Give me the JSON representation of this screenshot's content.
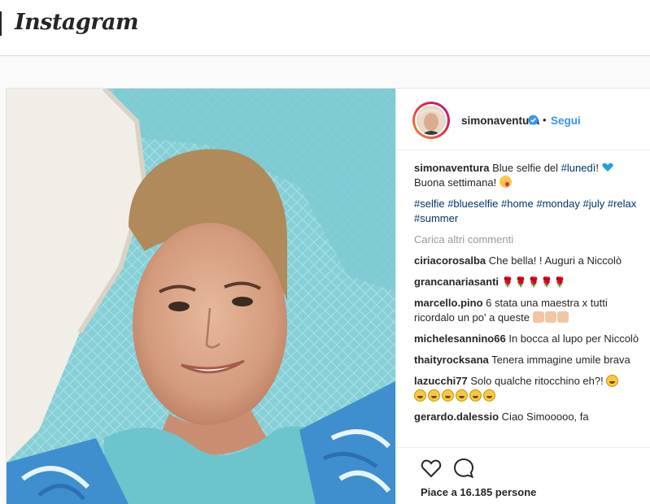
{
  "app": {
    "logo_text": "Instagram"
  },
  "post": {
    "author": "simonaventura",
    "verified": true,
    "follow_label": "Segui",
    "caption": {
      "username": "simonaventura",
      "text_before": "Blue selfie del ",
      "hashtag_inline": "#lunedì",
      "text_after": "! ",
      "line2": "Buona settimana! ",
      "hashtags": [
        "#selfie",
        "#blueselfie",
        "#home",
        "#monday",
        "#july",
        "#relax",
        "#summer"
      ]
    },
    "load_more_label": "Carica altri commenti",
    "comments": [
      {
        "user": "ciriacorosalba",
        "text": "Che bella! ! Auguri a Niccolò"
      },
      {
        "user": "grancanariasanti",
        "text": "🌹🌹🌹🌹🌹"
      },
      {
        "user": "marcello.pino",
        "text": "6 stata una maestra x tutti ricordalo un po' a queste"
      },
      {
        "user": "michelesannino66",
        "text": "In bocca al lupo per Niccolò"
      },
      {
        "user": "thaityrocksana",
        "text": "Tenera immagine umile brava"
      },
      {
        "user": "lazucchi77",
        "text": "Solo qualche ritocchino eh?!"
      },
      {
        "user": "gerardo.dalessio",
        "text": "Ciao Simooooo, fa"
      }
    ],
    "likes_label": "Piace a 16.185 persone",
    "icons": [
      "heart-icon",
      "comment-icon",
      "verified-badge-icon"
    ],
    "colors": {
      "link": "#3897f0",
      "hashtag": "#003569",
      "muted": "#999999",
      "text": "#262626"
    }
  }
}
